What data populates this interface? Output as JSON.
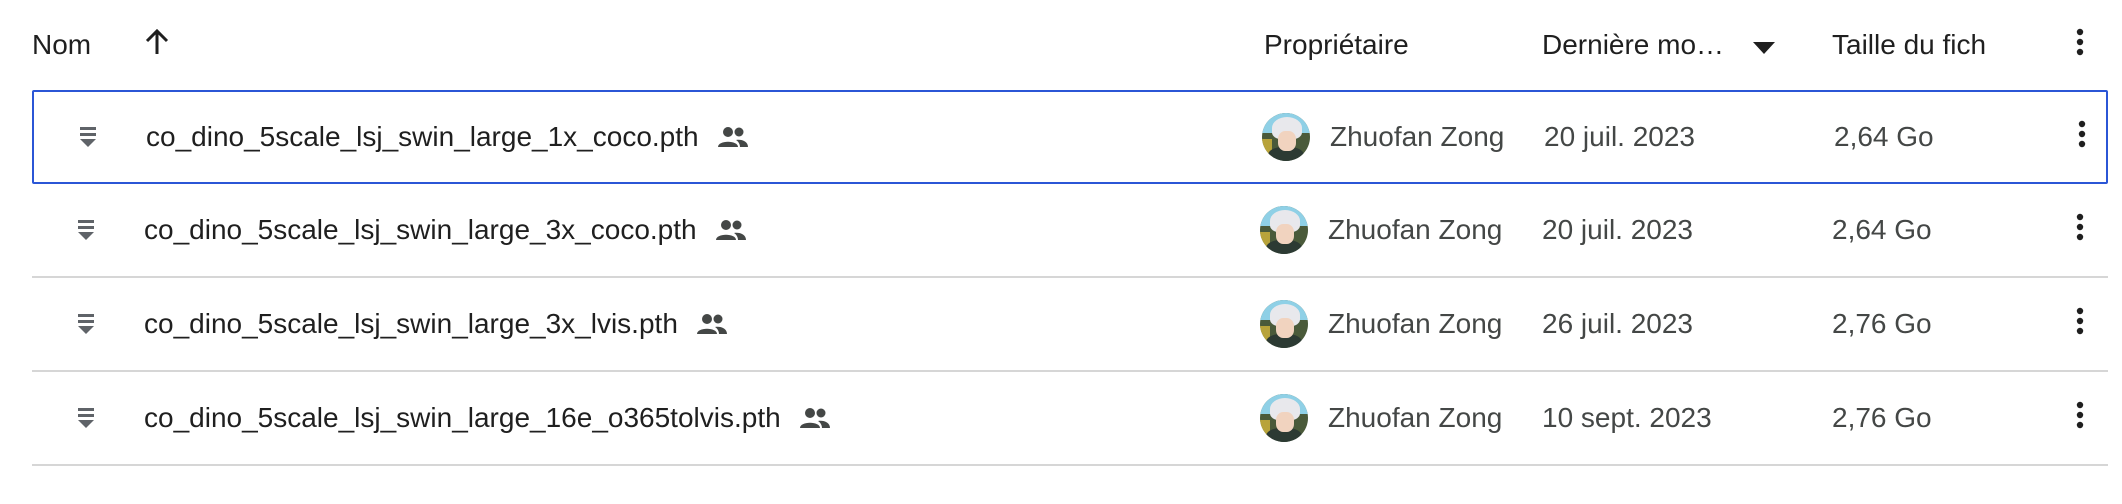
{
  "header": {
    "name": "Nom",
    "owner": "Propriétaire",
    "modified": "Dernière mo…",
    "size": "Taille du fich"
  },
  "rows": [
    {
      "name": "co_dino_5scale_lsj_swin_large_1x_coco.pth",
      "owner": "Zhuofan Zong",
      "date": "20 juil. 2023",
      "size": "2,64 Go"
    },
    {
      "name": "co_dino_5scale_lsj_swin_large_3x_coco.pth",
      "owner": "Zhuofan Zong",
      "date": "20 juil. 2023",
      "size": "2,64 Go"
    },
    {
      "name": "co_dino_5scale_lsj_swin_large_3x_lvis.pth",
      "owner": "Zhuofan Zong",
      "date": "26 juil. 2023",
      "size": "2,76 Go"
    },
    {
      "name": "co_dino_5scale_lsj_swin_large_16e_o365tolvis.pth",
      "owner": "Zhuofan Zong",
      "date": "10 sept. 2023",
      "size": "2,76 Go"
    }
  ],
  "icons": {
    "sort": "arrow-up-icon",
    "modified_sort": "caret-down-icon",
    "more": "more-vert-icon",
    "file": "file-icon",
    "shared": "people-icon"
  },
  "colors": {
    "selected_border": "#2b56d6",
    "divider": "#d6d6d6"
  }
}
